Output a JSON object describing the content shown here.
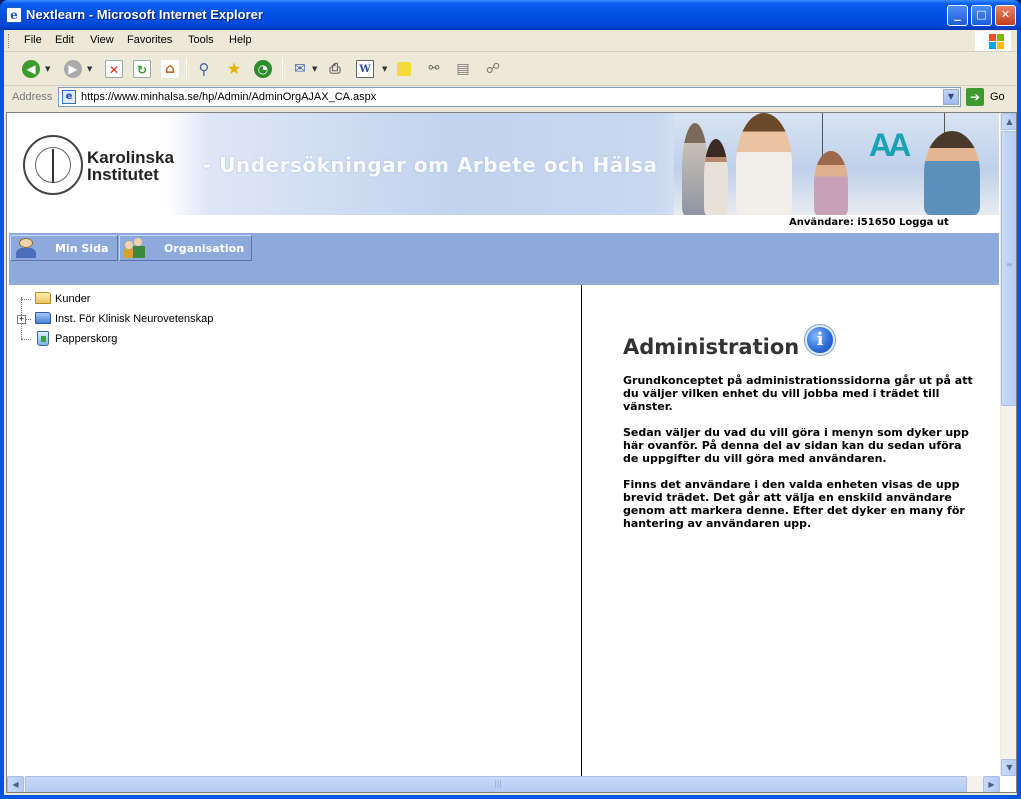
{
  "window": {
    "title": "Nextlearn - Microsoft Internet Explorer",
    "minimize": "_",
    "maximize": "□",
    "close": "✕"
  },
  "menubar": {
    "items": [
      "File",
      "Edit",
      "View",
      "Favorites",
      "Tools",
      "Help"
    ]
  },
  "toolbar": {
    "icons": [
      "back-icon",
      "forward-icon",
      "stop-icon",
      "refresh-icon",
      "home-icon",
      "search-icon",
      "favorites-icon",
      "history-icon",
      "mail-icon",
      "print-icon",
      "edit-icon",
      "discuss-icon",
      "messenger-icon",
      "research-icon",
      "bluetooth-icon"
    ]
  },
  "addressbar": {
    "label": "Address",
    "url": "https://www.minhalsa.se/hp/Admin/AdminOrgAJAX_CA.aspx",
    "go_label": "Go"
  },
  "page": {
    "header": {
      "logo_line1": "Karolinska",
      "logo_line2": "Institutet",
      "tagline": "- Undersökningar om Arbete och Hälsa",
      "brand_logo": "AA"
    },
    "user_line": "Användare: i51650 Logga ut",
    "nav": {
      "min_sida": "Min Sida",
      "organisation": "Organisation"
    },
    "tree": [
      {
        "label": "Kunder",
        "icon": "open-folder-icon"
      },
      {
        "label": "Inst. För Klinisk Neurovetenskap",
        "icon": "folder-icon"
      },
      {
        "label": "Papperskorg",
        "icon": "recycle-bin-icon"
      }
    ],
    "admin": {
      "title": "Administration",
      "info_glyph": "i",
      "paragraphs": [
        "Grundkonceptet på administrationssidorna går ut på att du väljer vilken enhet du vill jobba med i trädet till vänster.",
        "Sedan väljer du vad du vill göra i menyn som dyker upp här ovanför. På denna del av sidan kan du sedan uföra de uppgifter du vill göra med användaren.",
        "Finns det användare i den valda enheten visas de upp brevid trädet. Det går att välja en enskild användare genom att markera denne. Efter det dyker en many för hantering av användaren upp."
      ]
    }
  },
  "colors": {
    "titlebar": "#0050e0",
    "nav_band": "#8eaadb",
    "chrome": "#ece9d8"
  }
}
